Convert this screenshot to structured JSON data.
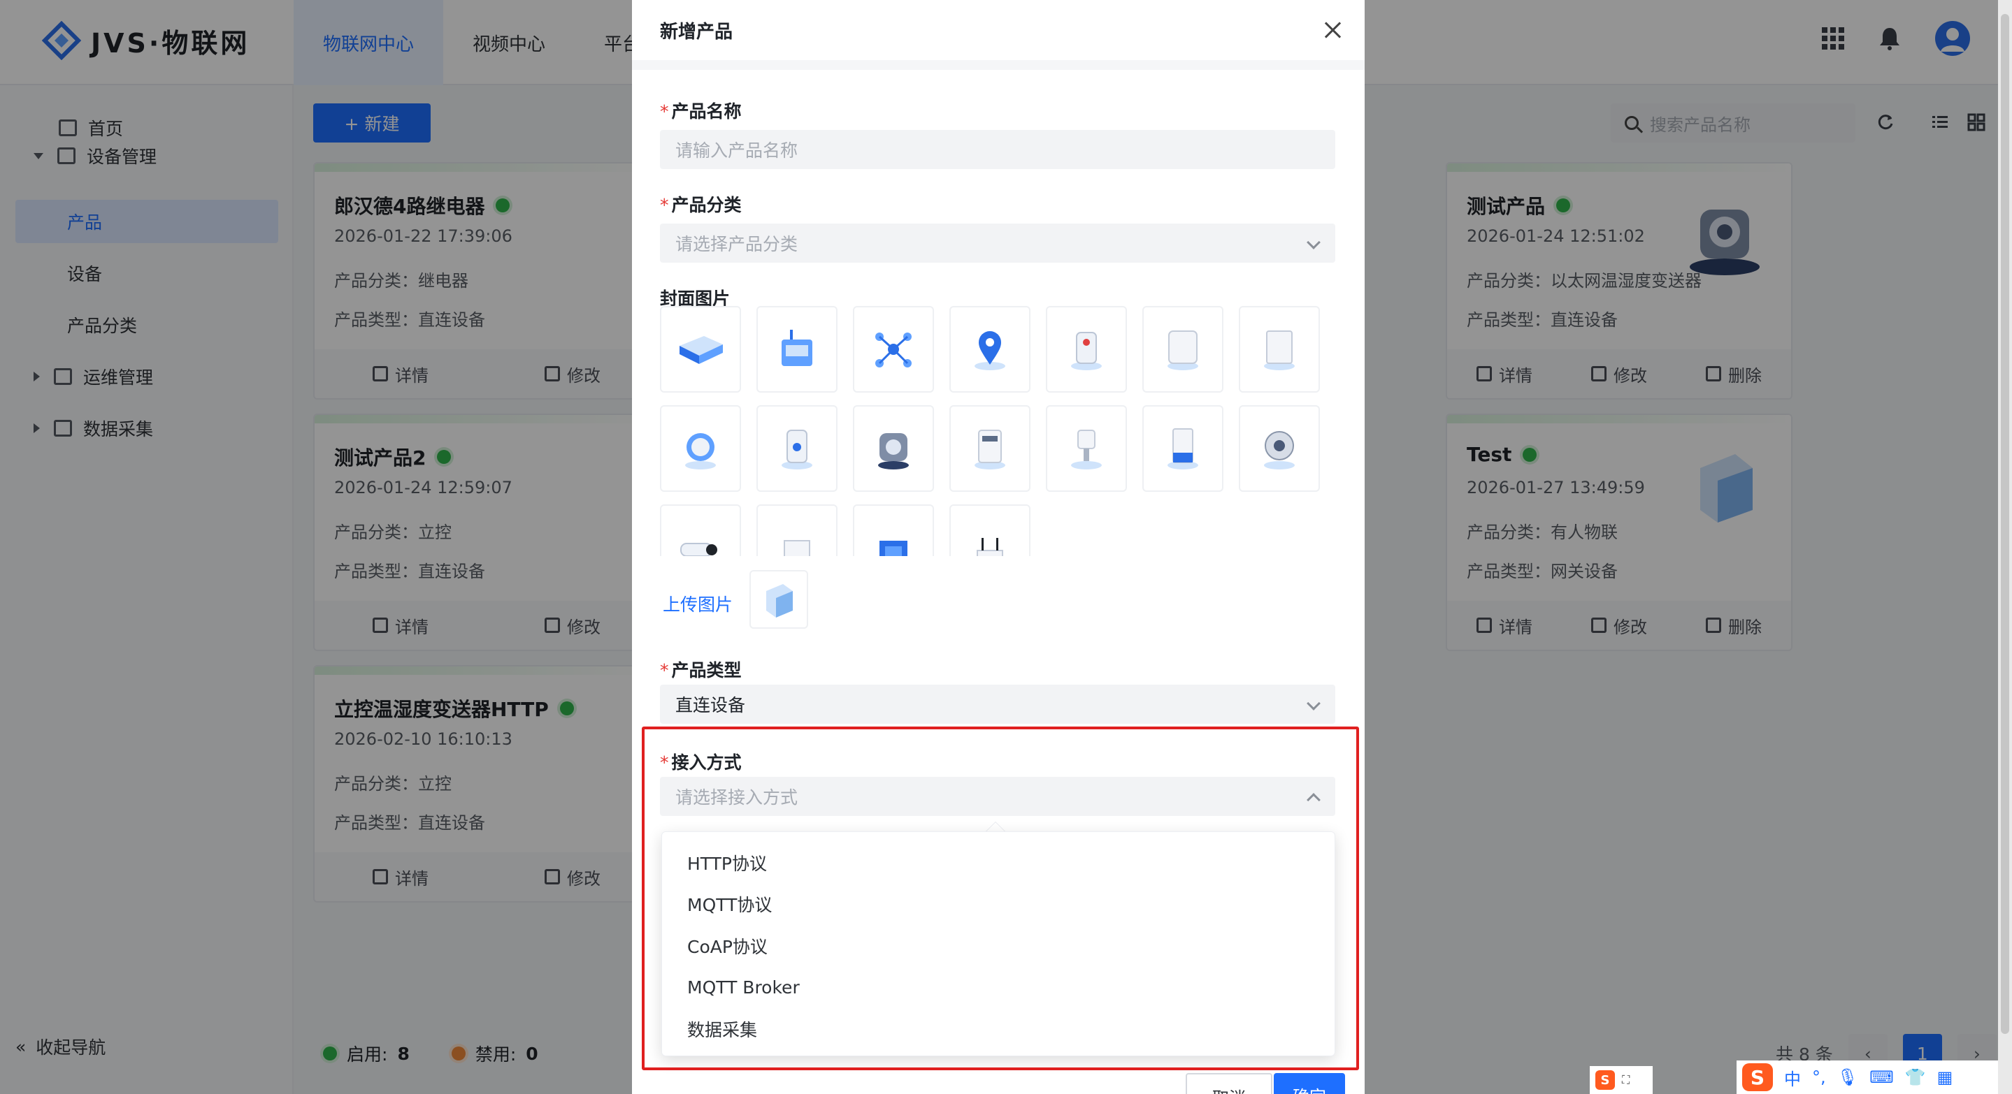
{
  "app": {
    "logo_text": "JVS·物联网"
  },
  "topnav": {
    "items": [
      "物联网中心",
      "视频中心",
      "平台"
    ]
  },
  "sidebar": {
    "items": [
      {
        "label": "首页"
      },
      {
        "label": "设备管理"
      },
      {
        "label": "产品"
      },
      {
        "label": "设备"
      },
      {
        "label": "产品分类"
      },
      {
        "label": "运维管理"
      },
      {
        "label": "数据采集"
      }
    ],
    "collapse_label": "收起导航"
  },
  "toolbar": {
    "new_label": "+ 新建",
    "search_placeholder": "搜索产品名称"
  },
  "cards": [
    {
      "title": "郎汉德4路继电器",
      "date": "2026-01-22 17:39:06",
      "category": "产品分类：继电器",
      "type": "产品类型：直连设备",
      "detail": "详情",
      "edit": "修改"
    },
    {
      "title": "测试产品2",
      "date": "2026-01-24 12:59:07",
      "category": "产品分类：立控",
      "type": "产品类型：直连设备",
      "detail": "详情",
      "edit": "修改"
    },
    {
      "title": "立控温湿度变送器HTTP",
      "date": "2026-02-10 16:10:13",
      "category": "产品分类：立控",
      "type": "产品类型：直连设备",
      "detail": "详情",
      "edit": "修改"
    },
    {
      "title": "测试产品",
      "date": "2026-01-24 12:51:02",
      "category": "产品分类：以太网温湿度变送器",
      "type": "产品类型：直连设备",
      "detail": "详情",
      "edit": "修改",
      "delete": "删除"
    },
    {
      "title": "Test",
      "date": "2026-01-27 13:49:59",
      "category": "产品分类：有人物联",
      "type": "产品类型：网关设备",
      "detail": "详情",
      "edit": "修改",
      "delete": "删除"
    }
  ],
  "footer": {
    "enabled_label": "启用:",
    "enabled_count": "8",
    "disabled_label": "禁用:",
    "disabled_count": "0",
    "total": "共 8 条",
    "page": "1"
  },
  "modal": {
    "title": "新增产品",
    "name_label": "产品名称",
    "name_placeholder": "请输入产品名称",
    "category_label": "产品分类",
    "category_placeholder": "请选择产品分类",
    "cover_label": "封面图片",
    "upload_label": "上传图片",
    "type_label": "产品类型",
    "type_value": "直连设备",
    "access_label": "接入方式",
    "access_placeholder": "请选择接入方式",
    "access_options": [
      "HTTP协议",
      "MQTT协议",
      "CoAP协议",
      "MQTT Broker",
      "数据采集"
    ],
    "cancel_label": "取消",
    "ok_label": "确定"
  },
  "ime": {
    "mode": "中",
    "punct": "°,",
    "s_logo": "S"
  },
  "colors": {
    "primary": "#1e6fff",
    "success": "#2fb34a",
    "warning": "#f0883a",
    "danger": "#e02020"
  }
}
